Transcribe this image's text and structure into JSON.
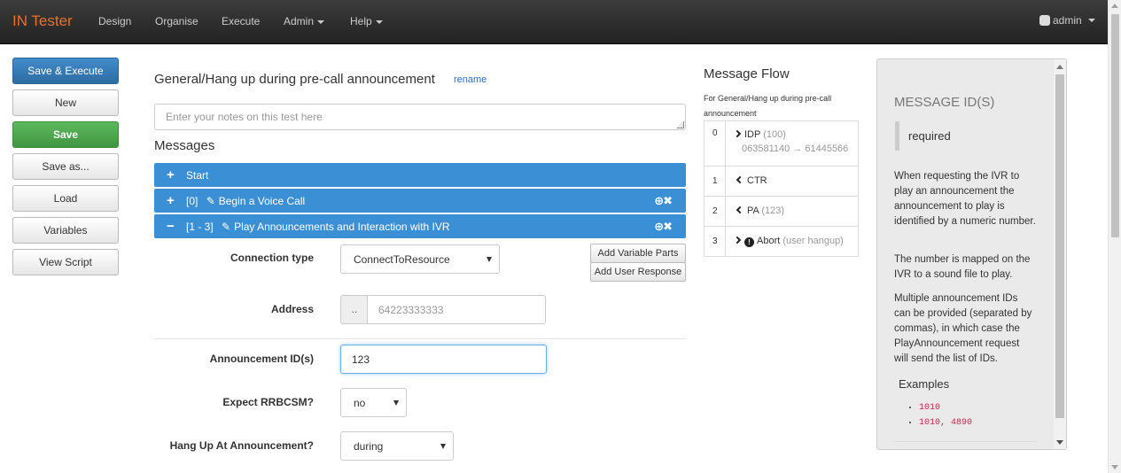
{
  "navbar": {
    "brand": "IN Tester",
    "items": [
      "Design",
      "Organise",
      "Execute",
      "Admin",
      "Help"
    ],
    "user": "admin"
  },
  "sidebar": {
    "buttons": [
      "Save & Execute",
      "New",
      "Save",
      "Save as...",
      "Load",
      "Variables",
      "View Script"
    ]
  },
  "main": {
    "title": "General/Hang up during pre-call announcement",
    "rename": "rename",
    "notes_placeholder": "Enter your notes on this test here",
    "messages_heading": "Messages",
    "bars": [
      {
        "sign": "+",
        "label": "Start"
      },
      {
        "sign": "+",
        "label": "[0]  Begin a Voice Call",
        "controls": "⊕✖"
      },
      {
        "sign": "−",
        "label": "[1 - 3]  Play Announcements and Interaction with IVR",
        "controls": "⊕✖"
      }
    ],
    "form": {
      "connection_type_label": "Connection type",
      "connection_type_value": "ConnectToResource",
      "add_variable_parts": "Add Variable Parts",
      "add_user_response": "Add User Response",
      "address_label": "Address",
      "address_prefix": "..",
      "address_placeholder": "64223333333",
      "announcement_label": "Announcement ID(s)",
      "announcement_value": "123",
      "expect_label": "Expect RRBCSM?",
      "expect_value": "no",
      "hangup_label": "Hang Up At Announcement?",
      "hangup_value": "during"
    }
  },
  "flow": {
    "title": "Message Flow",
    "subtitle": "For General/Hang up during pre-call announcement",
    "rows": [
      {
        "idx": "0",
        "name": "IDP",
        "extra": "(100)",
        "detail": "063581140 → 61445566",
        "dir": "right"
      },
      {
        "idx": "1",
        "name": "CTR",
        "extra": "",
        "dir": "left"
      },
      {
        "idx": "2",
        "name": "PA",
        "extra": "(123)",
        "dir": "left"
      },
      {
        "idx": "3",
        "name": "Abort",
        "extra": "(user hangup)",
        "dir": "right"
      }
    ]
  },
  "help": {
    "title": "MESSAGE ID(S)",
    "required": "required",
    "para1": "When requesting the IVR to play an announcement the announcement to play is identified by a numeric number.",
    "para2": "The number is mapped on the IVR to a sound file to play.",
    "para3": "Multiple announcement IDs can be provided (separated by commas), in which case the PlayAnnouncement request will send the list of IDs.",
    "examples_heading": "Examples",
    "examples": [
      "1010",
      "1010, 4890"
    ]
  },
  "colors": {
    "brand": "#e9712b",
    "primary": "#428bca",
    "success": "#5cb85c",
    "message_bar": "#3b8fd5"
  }
}
